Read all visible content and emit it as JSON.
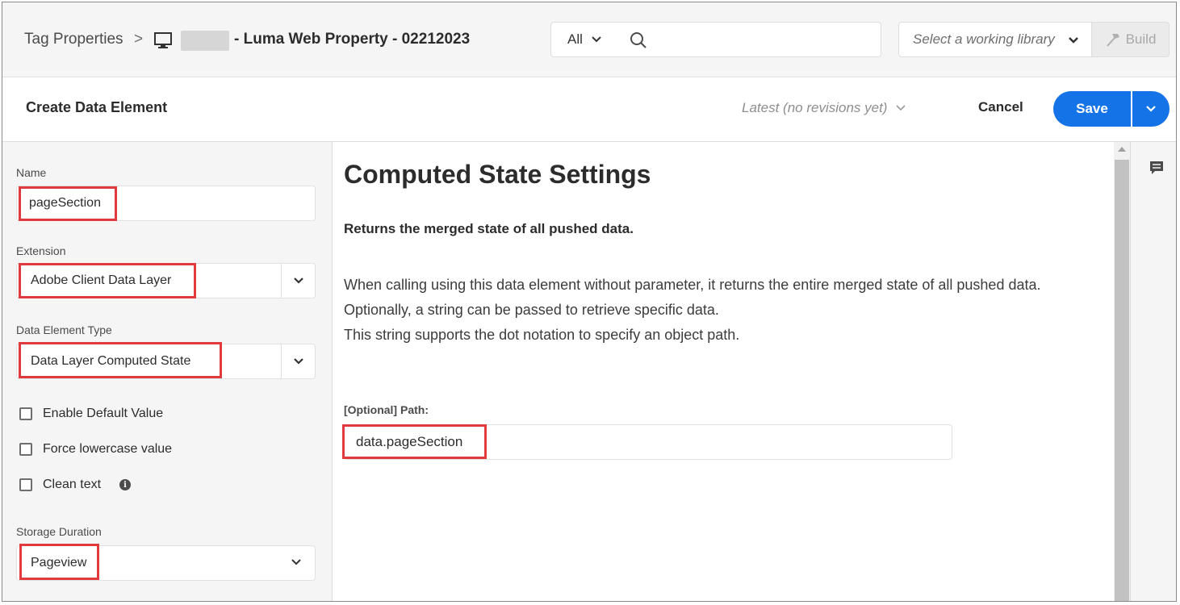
{
  "topbar": {
    "breadcrumb_root": "Tag Properties",
    "breadcrumb_separator": ">",
    "property_name": "- Luma Web Property - 02212023",
    "search_scope": "All",
    "search_placeholder": "",
    "library_placeholder": "Select a working library",
    "build_label": "Build"
  },
  "header": {
    "title": "Create Data Element",
    "revisions": "Latest (no revisions yet)",
    "cancel_label": "Cancel",
    "save_label": "Save"
  },
  "form": {
    "name_label": "Name",
    "name_value": "pageSection",
    "extension_label": "Extension",
    "extension_value": "Adobe Client Data Layer",
    "type_label": "Data Element Type",
    "type_value": "Data Layer Computed State",
    "checkboxes": [
      {
        "label": "Enable Default Value",
        "checked": false
      },
      {
        "label": "Force lowercase value",
        "checked": false
      },
      {
        "label": "Clean text",
        "checked": false
      }
    ],
    "storage_label": "Storage Duration",
    "storage_value": "Pageview"
  },
  "main": {
    "title": "Computed State Settings",
    "subtitle": "Returns the merged state of all pushed data.",
    "description_lines": [
      "When calling using this data element without parameter, it returns the entire merged state of all pushed data.",
      "Optionally, a string can be passed to retrieve specific data.",
      "This string supports the dot notation to specify an object path."
    ],
    "path_label": "[Optional] Path:",
    "path_value": "data.pageSection"
  },
  "icons": {
    "device": "desktop-icon",
    "search": "search-icon",
    "build": "hammer-icon",
    "comment": "comment-icon",
    "info": "info-icon"
  },
  "colors": {
    "accent": "#1473e6",
    "highlight": "#e0393e"
  }
}
